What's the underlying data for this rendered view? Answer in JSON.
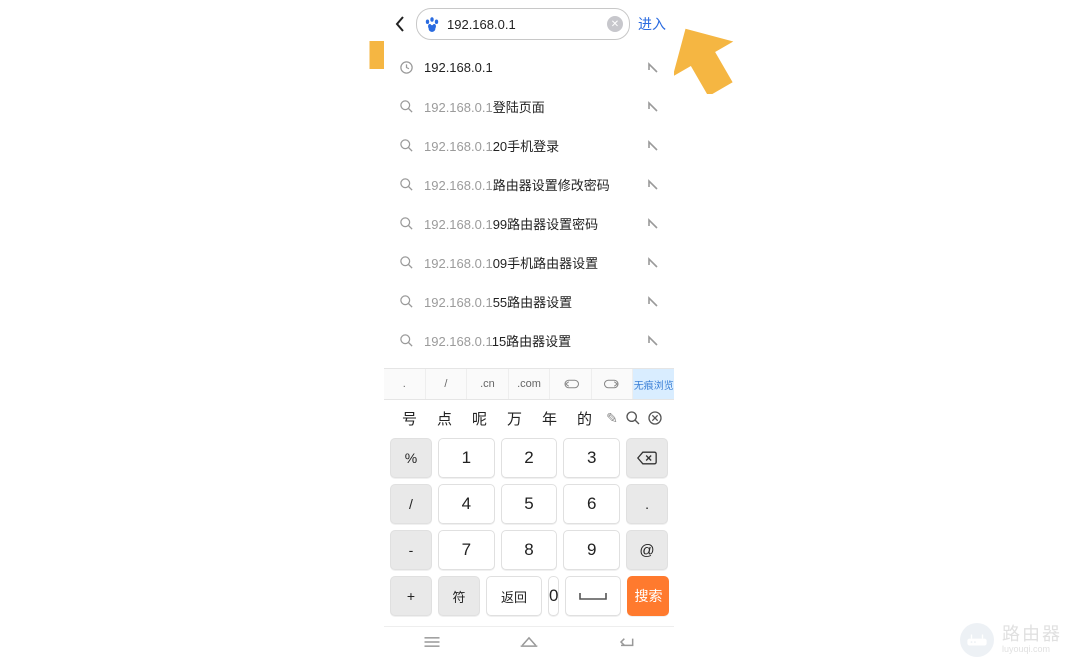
{
  "topbar": {
    "search_value": "192.168.0.1",
    "enter_label": "进入"
  },
  "suggestions": [
    {
      "icon": "clock",
      "prefix": "",
      "rest": "192.168.0.1"
    },
    {
      "icon": "search",
      "prefix": "192.168.0.1",
      "rest": "登陆页面"
    },
    {
      "icon": "search",
      "prefix": "192.168.0.1",
      "rest": "20手机登录"
    },
    {
      "icon": "search",
      "prefix": "192.168.0.1",
      "rest": "路由器设置修改密码"
    },
    {
      "icon": "search",
      "prefix": "192.168.0.1",
      "rest": "99路由器设置密码"
    },
    {
      "icon": "search",
      "prefix": "192.168.0.1",
      "rest": "09手机路由器设置"
    },
    {
      "icon": "search",
      "prefix": "192.168.0.1",
      "rest": "55路由器设置"
    },
    {
      "icon": "search",
      "prefix": "192.168.0.1",
      "rest": "15路由器设置"
    }
  ],
  "urlbar": {
    "dot": ".",
    "slash": "/",
    "cn": ".cn",
    "com": ".com",
    "incognito": "无痕浏览"
  },
  "predictions": [
    "号",
    "点",
    "呢",
    "万",
    "年",
    "的"
  ],
  "pred_edit": "✎",
  "keypad": {
    "rows": [
      {
        "side": "%",
        "keys": [
          "1",
          "2",
          "3"
        ],
        "right": {
          "type": "bksp"
        }
      },
      {
        "side": "/",
        "keys": [
          "4",
          "5",
          "6"
        ],
        "right": {
          "type": "text",
          "label": "."
        }
      },
      {
        "side": "-",
        "keys": [
          "7",
          "8",
          "9"
        ],
        "right": {
          "type": "text",
          "label": "@"
        }
      },
      {
        "side": "+",
        "keys": [],
        "right": null
      }
    ],
    "bottom": {
      "sym": "符",
      "return": "返回",
      "zero": "0",
      "search": "搜索"
    }
  },
  "watermark": {
    "title": "路由器",
    "sub": "luyouqi.com"
  }
}
